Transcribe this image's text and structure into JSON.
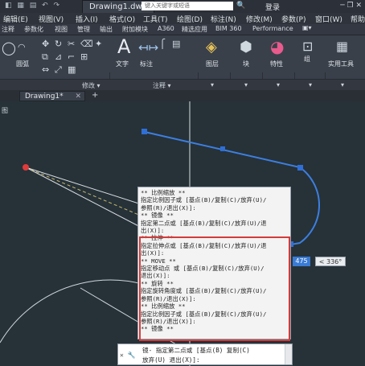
{
  "titlebar": {
    "file_tab": "Drawing1.dwg",
    "search_placeholder": "键入关键字或短语",
    "login": "登录",
    "qa_icons": "◧ ▦ ▤ ↶ ↷",
    "winctl": "─ ❐ ✕"
  },
  "menu": [
    "编辑(E)",
    "视图(V)",
    "插入(I)",
    "格式(O)",
    "工具(T)",
    "绘图(D)",
    "标注(N)",
    "修改(M)",
    "参数(P)",
    "窗口(W)",
    "帮助"
  ],
  "ribbon_tabs": [
    "注释",
    "参数化",
    "视图",
    "管理",
    "输出",
    "附加模块",
    "A360",
    "精选应用",
    "BIM 360",
    "Performance"
  ],
  "ribbon": {
    "draw_labels": [
      "圆弧"
    ],
    "big_buttons": [
      "文字",
      "标注",
      "图层",
      "块",
      "特性",
      "组",
      "实用工具"
    ],
    "panels": [
      "修改 ▾",
      "注释 ▾"
    ]
  },
  "document": {
    "tab": "Drawing1*",
    "viewport_label": "图"
  },
  "command_history": [
    "** 比例缩放 **",
    "指定比例因子或 [基点(B)/复制(C)/放弃(U)/",
    "参照(R)/退出(X)]:",
    "** 镜像 **",
    "指定第二点或 [基点(B)/复制(C)/放弃(U)/退",
    "出(X)]:",
    "** 拉伸 **",
    "指定拉伸点或 [基点(B)/复制(C)/放弃(U)/退",
    "出(X)]:",
    "** MOVE **",
    "指定移动点 或 [基点(B)/复制(C)/放弃(U)/",
    "退出(X)]:",
    "** 旋转 **",
    "指定旋转角度或 [基点(B)/复制(C)/放弃(U)/",
    "参照(R)/退出(X)]:",
    "** 比例缩放 **",
    "指定比例因子或 [基点(B)/复制(C)/放弃(U)/",
    "参照(R)/退出(X)]:",
    "** 镜像 **"
  ],
  "command_line": {
    "line1": "镜- 指定第二点或 [基点(B) 复制(C)",
    "line2": "放弃(U) 退出(X)]:"
  },
  "dynamic_input": {
    "value": "475",
    "angle": "< 336°"
  },
  "colors": {
    "canvas": "#263238",
    "grip": "#2f6fd6",
    "selected_line": "#3d7fe0",
    "red_highlight": "#d33b3b"
  }
}
